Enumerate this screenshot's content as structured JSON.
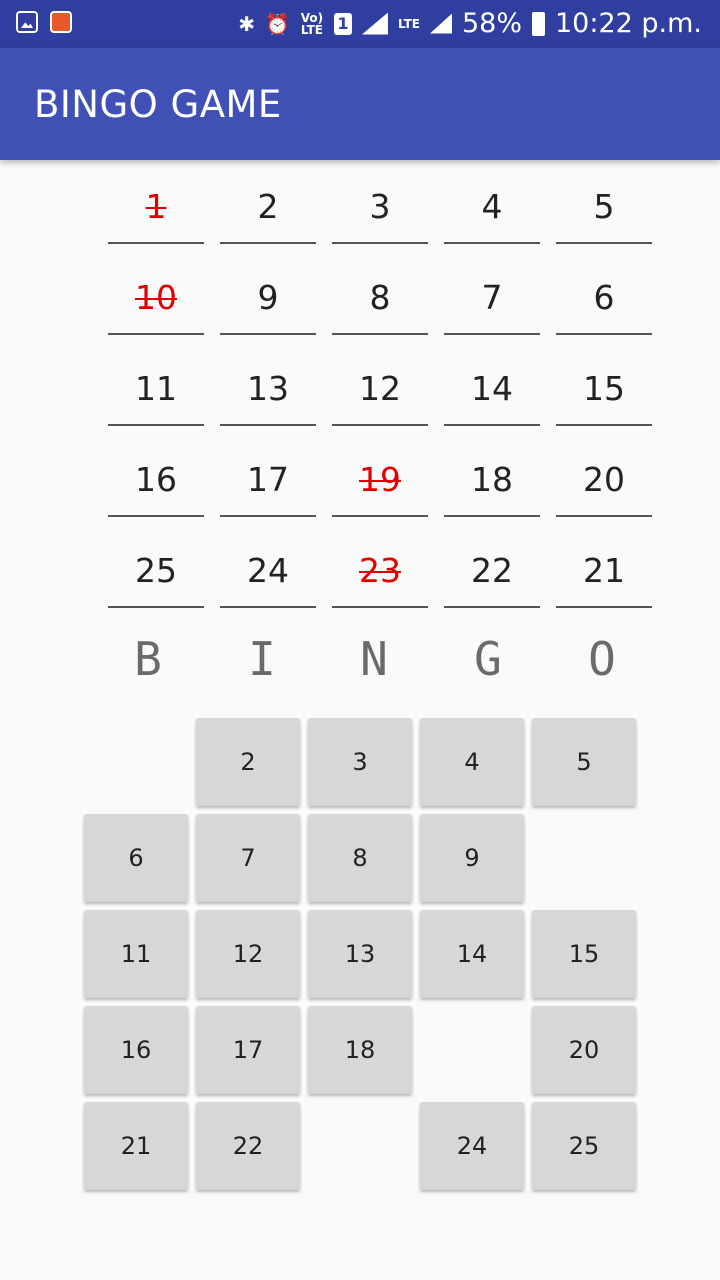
{
  "status_bar": {
    "network_top": "Vo) LTE",
    "sim_slot": "1",
    "lte_label": "LTE",
    "battery_percent": "58%",
    "time": "10:22 p.m.",
    "icons": [
      "gallery-icon",
      "app-notification-icon",
      "bluetooth-icon",
      "alarm-icon",
      "volte-icon",
      "sim-icon",
      "signal-icon",
      "battery-icon"
    ]
  },
  "app_bar": {
    "title": "BINGO GAME"
  },
  "number_grid": {
    "rows": [
      [
        {
          "value": "1",
          "marked": true
        },
        {
          "value": "2",
          "marked": false
        },
        {
          "value": "3",
          "marked": false
        },
        {
          "value": "4",
          "marked": false
        },
        {
          "value": "5",
          "marked": false
        }
      ],
      [
        {
          "value": "10",
          "marked": true
        },
        {
          "value": "9",
          "marked": false
        },
        {
          "value": "8",
          "marked": false
        },
        {
          "value": "7",
          "marked": false
        },
        {
          "value": "6",
          "marked": false
        }
      ],
      [
        {
          "value": "11",
          "marked": false
        },
        {
          "value": "13",
          "marked": false
        },
        {
          "value": "12",
          "marked": false
        },
        {
          "value": "14",
          "marked": false
        },
        {
          "value": "15",
          "marked": false
        }
      ],
      [
        {
          "value": "16",
          "marked": false
        },
        {
          "value": "17",
          "marked": false
        },
        {
          "value": "19",
          "marked": true
        },
        {
          "value": "18",
          "marked": false
        },
        {
          "value": "20",
          "marked": false
        }
      ],
      [
        {
          "value": "25",
          "marked": false
        },
        {
          "value": "24",
          "marked": false
        },
        {
          "value": "23",
          "marked": true
        },
        {
          "value": "22",
          "marked": false
        },
        {
          "value": "21",
          "marked": false
        }
      ]
    ],
    "marked_color": "#e00000"
  },
  "bingo_letters": [
    "B",
    "I",
    "N",
    "G",
    "O"
  ],
  "button_grid": {
    "rows": [
      [
        "",
        "2",
        "3",
        "4",
        "5"
      ],
      [
        "6",
        "7",
        "8",
        "9",
        ""
      ],
      [
        "11",
        "12",
        "13",
        "14",
        "15"
      ],
      [
        "16",
        "17",
        "18",
        "",
        "20"
      ],
      [
        "21",
        "22",
        "",
        "24",
        "25"
      ]
    ]
  },
  "colors": {
    "status_bar": "#303f9f",
    "app_bar": "#3f51b5",
    "tile": "#d6d7d7",
    "letter": "#6a6a6a"
  }
}
